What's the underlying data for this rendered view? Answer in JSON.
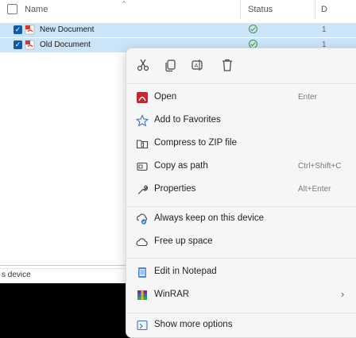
{
  "explorer": {
    "columns": {
      "name": "Name",
      "status": "Status",
      "date": "D"
    },
    "files": [
      {
        "name": "New Document",
        "date": "1"
      },
      {
        "name": "Old Document",
        "date": "1"
      }
    ],
    "left_pane_label": "s device"
  },
  "context_menu": {
    "toolbar": [
      "cut-icon",
      "copy-icon",
      "rename-icon",
      "delete-icon"
    ],
    "items": [
      {
        "label": "Open",
        "shortcut": "Enter",
        "icon": "pdf-app-icon"
      },
      {
        "label": "Add to Favorites",
        "icon": "star-icon"
      },
      {
        "label": "Compress to ZIP file",
        "icon": "zip-folder-icon"
      },
      {
        "label": "Copy as path",
        "shortcut": "Ctrl+Shift+C",
        "icon": "copy-path-icon"
      },
      {
        "label": "Properties",
        "shortcut": "Alt+Enter",
        "icon": "wrench-icon"
      },
      {
        "label": "Always keep on this device",
        "icon": "cloud-sync-icon"
      },
      {
        "label": "Free up space",
        "icon": "cloud-icon"
      },
      {
        "label": "Edit in Notepad",
        "icon": "notepad-icon"
      },
      {
        "label": "WinRAR",
        "icon": "winrar-icon"
      },
      {
        "label": "Show more options",
        "icon": "more-options-icon"
      }
    ]
  },
  "colors": {
    "selection": "#cce4f7",
    "checkbox_accent": "#0b5cad",
    "status_ok": "#3a9b3a",
    "menu_background": "#f6f6f6"
  }
}
